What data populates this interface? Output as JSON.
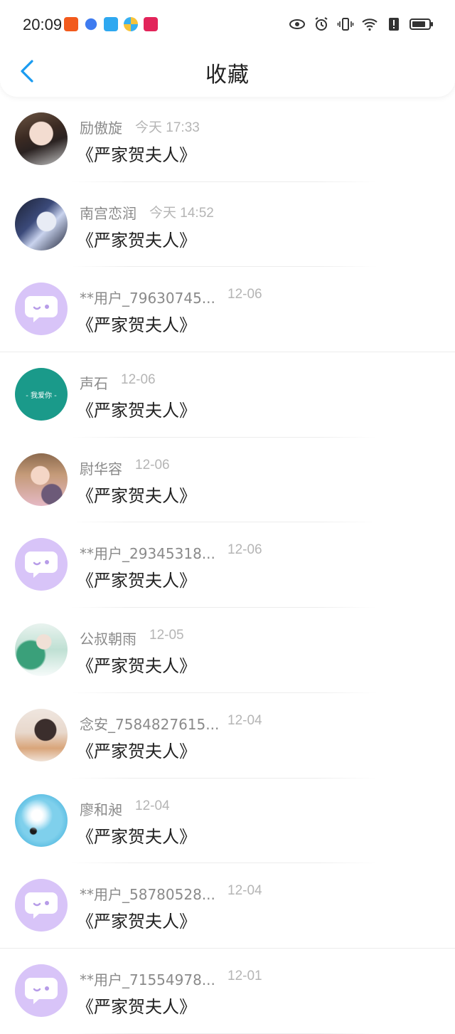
{
  "status_bar": {
    "time": "20:09",
    "app_icons": [
      "kuaishou-icon",
      "browser-icon",
      "weather-icon",
      "pinwheel-icon",
      "video-icon"
    ],
    "system_icons": [
      "eye-icon",
      "alarm-icon",
      "vibrate-icon",
      "wifi-icon",
      "alert-icon",
      "battery-icon"
    ]
  },
  "nav": {
    "title": "收藏"
  },
  "items": [
    {
      "name": "励傲旋",
      "date": "今天 17:33",
      "book": "《严家贺夫人》",
      "avatar": "photo-boy"
    },
    {
      "name": "南宫恋润",
      "date": "今天 14:52",
      "book": "《严家贺夫人》",
      "avatar": "photo-book"
    },
    {
      "name": "**用户_79630745...",
      "date": "12-06",
      "book": "《严家贺夫人》",
      "avatar": "default"
    },
    {
      "name": "声石",
      "date": "12-06",
      "book": "《严家贺夫人》",
      "avatar": "teal",
      "avatar_text": "- 我爱你 -"
    },
    {
      "name": "尉华容",
      "date": "12-06",
      "book": "《严家贺夫人》",
      "avatar": "photo-girl"
    },
    {
      "name": "**用户_29345318...",
      "date": "12-06",
      "book": "《严家贺夫人》",
      "avatar": "default"
    },
    {
      "name": "公叔朝雨",
      "date": "12-05",
      "book": "《严家贺夫人》",
      "avatar": "photo-anime"
    },
    {
      "name": "念安_7584827615...",
      "date": "12-04",
      "book": "《严家贺夫人》",
      "avatar": "photo-woman"
    },
    {
      "name": "廖和昶",
      "date": "12-04",
      "book": "《严家贺夫人》",
      "avatar": "photo-dandelion"
    },
    {
      "name": "**用户_58780528...",
      "date": "12-04",
      "book": "《严家贺夫人》",
      "avatar": "default"
    },
    {
      "name": "**用户_71554978...",
      "date": "12-01",
      "book": "《严家贺夫人》",
      "avatar": "default"
    }
  ],
  "colors": {
    "accent": "#1a9bf0",
    "default_avatar": "#d8c4f8",
    "teal_avatar": "#1a9a8a"
  }
}
